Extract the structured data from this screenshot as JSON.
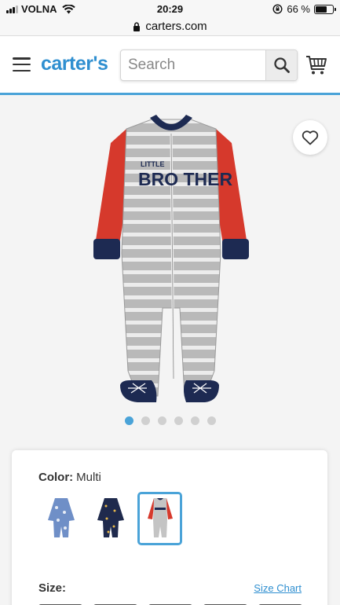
{
  "status_bar": {
    "carrier": "VOLNA",
    "time": "20:29",
    "battery": "66 %",
    "battery_level": 0.66
  },
  "browser": {
    "url": "carters.com"
  },
  "header": {
    "logo": "carter's",
    "search": {
      "placeholder": "Search",
      "value": ""
    },
    "icons": [
      "menu-icon",
      "search-icon",
      "cart-icon"
    ]
  },
  "product": {
    "print": {
      "line1": "LITTLE",
      "line2": "BRO THER"
    },
    "carousel": {
      "count": 6,
      "active_index": 0
    },
    "favorite_icon": "heart-icon"
  },
  "options": {
    "color_label": "Color:",
    "color_value": "Multi",
    "swatches": [
      {
        "name": "blue-print",
        "selected": false
      },
      {
        "name": "navy-print",
        "selected": false
      },
      {
        "name": "multi",
        "selected": true
      }
    ],
    "size_label": "Size:",
    "size_chart_link": "Size Chart"
  },
  "colors": {
    "brand": "#2f8fd0",
    "accent": "#4aa3d8",
    "sleeve_red": "#d6392c",
    "navy": "#1d2a52"
  }
}
